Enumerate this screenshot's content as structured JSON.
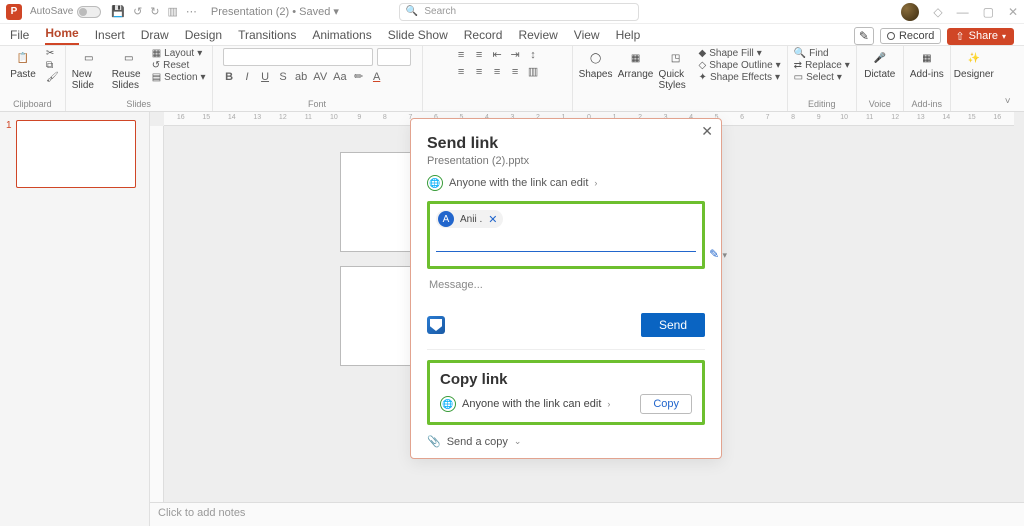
{
  "titlebar": {
    "autosave_label": "AutoSave",
    "doc_name": "Presentation (2) • Saved ▾",
    "search_placeholder": "Search"
  },
  "tabs": {
    "items": [
      "File",
      "Home",
      "Insert",
      "Draw",
      "Design",
      "Transitions",
      "Animations",
      "Slide Show",
      "Record",
      "Review",
      "View",
      "Help"
    ],
    "record_btn": "Record",
    "share_btn": "Share"
  },
  "ribbon": {
    "clipboard": {
      "paste": "Paste",
      "label": "Clipboard"
    },
    "slides": {
      "new_slide": "New Slide",
      "reuse": "Reuse Slides",
      "layout": "Layout",
      "reset": "Reset",
      "section": "Section",
      "label": "Slides"
    },
    "font_label": "Font",
    "find": "Find",
    "replace": "Replace",
    "select": "Select",
    "editing_label": "Editing",
    "dictate": "Dictate",
    "voice_label": "Voice",
    "addins": "Add-ins",
    "addins_label": "Add-ins",
    "designer": "Designer",
    "shapes": "Shapes",
    "arrange": "Arrange",
    "quick": "Quick Styles",
    "shape_fill": "Shape Fill",
    "shape_outline": "Shape Outline",
    "shape_effects": "Shape Effects"
  },
  "ruler_numbers": [
    "16",
    "15",
    "14",
    "13",
    "12",
    "11",
    "10",
    "9",
    "8",
    "7",
    "6",
    "5",
    "4",
    "3",
    "2",
    "1",
    "0",
    "1",
    "2",
    "3",
    "4",
    "5",
    "6",
    "7",
    "8",
    "9",
    "10",
    "11",
    "12",
    "13",
    "14",
    "15",
    "16"
  ],
  "thumb_index": "1",
  "notes_placeholder": "Click to add notes",
  "dialog": {
    "title": "Send link",
    "subtitle": "Presentation (2).pptx",
    "perm_text": "Anyone with the link can edit",
    "recipient_initial": "A",
    "recipient_name": "Anii .",
    "message_placeholder": "Message...",
    "send_btn": "Send",
    "copy_title": "Copy link",
    "copy_perm": "Anyone with the link can edit",
    "copy_btn": "Copy",
    "send_copy": "Send a copy"
  }
}
